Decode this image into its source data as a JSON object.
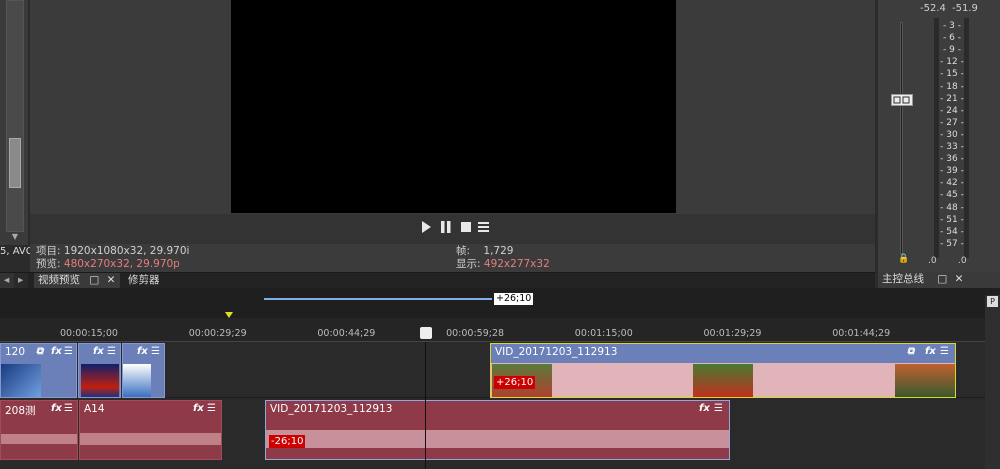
{
  "left_panel": {
    "cut_text": "5, AVC"
  },
  "preview": {
    "info": {
      "project_label": "项目:",
      "project_value": "1920x1080x32, 29.970i",
      "preview_label": "预览:",
      "preview_value": "480x270x32, 29.970p",
      "frame_label": "帧:",
      "frame_value": "1,729",
      "display_label": "显示:",
      "display_value": "492x277x32"
    }
  },
  "tabs": {
    "video_preview": "视频预览",
    "trimmer": "修剪器",
    "master_bus": "主控总线"
  },
  "master": {
    "peak_left": "-52.4",
    "peak_right": "-51.9",
    "scale": [
      "3",
      "6",
      "9",
      "12",
      "15",
      "18",
      "21",
      "24",
      "27",
      "30",
      "33",
      "36",
      "39",
      "42",
      "45",
      "48",
      "51",
      "54",
      "57"
    ],
    "bottom_left": ".0",
    "bottom_right": ".0"
  },
  "timeline": {
    "loop_label": "+26;10",
    "ticks": [
      "00:00:15;00",
      "00:00:29;29",
      "00:00:44;29",
      "00:00:59;28",
      "00:01:15;00",
      "00:01:29;29",
      "00:01:44;29"
    ],
    "video_clips": [
      {
        "title": "120"
      },
      {
        "title": ""
      },
      {
        "title": ""
      },
      {
        "title": "VID_20171203_112913",
        "badge": "+26;10"
      }
    ],
    "audio_clips": [
      {
        "title": "208测"
      },
      {
        "title": "A14"
      },
      {
        "title": "VID_20171203_112913",
        "badge": "-26;10"
      }
    ]
  },
  "colors": {
    "video_clip": "#6b7fb8",
    "audio_clip": "#8e3a48",
    "selected_outline": "#d9d92b"
  }
}
